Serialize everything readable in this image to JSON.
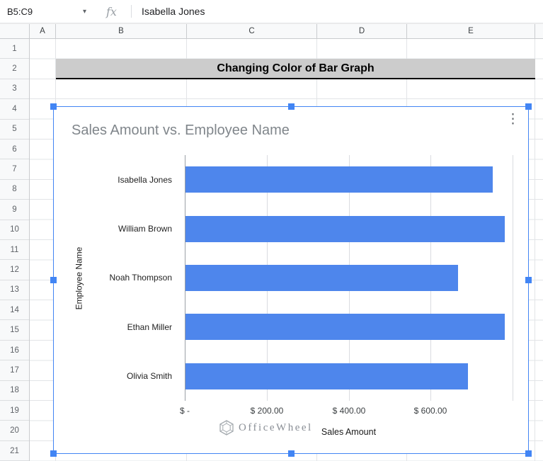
{
  "formula_bar": {
    "range": "B5:C9",
    "fx_label": "fx",
    "content": "Isabella Jones"
  },
  "icons": {
    "name_box_dropdown": "▾",
    "chart_menu": "⋮"
  },
  "colors": {
    "selection": "#4285f4"
  },
  "sheet": {
    "columns": [
      "A",
      "B",
      "C",
      "D",
      "E"
    ],
    "rows": [
      "1",
      "2",
      "3",
      "4",
      "5",
      "6",
      "7",
      "8",
      "9",
      "10",
      "11",
      "12",
      "13",
      "14",
      "15",
      "16",
      "17",
      "18",
      "19",
      "20",
      "21"
    ],
    "title_cell": {
      "text": "Changing Color of Bar Graph",
      "bg": "#cccccc"
    }
  },
  "chart": {
    "watermark": "OfficeWheel"
  },
  "chart_data": {
    "type": "bar",
    "orientation": "horizontal",
    "title": "Sales Amount vs. Employee Name",
    "categories": [
      "Isabella Jones",
      "William Brown",
      "Noah Thompson",
      "Ethan Miller",
      "Olivia Smith"
    ],
    "values": [
      750,
      780,
      665,
      780,
      690
    ],
    "xlabel": "Sales Amount",
    "ylabel": "Employee Name",
    "x_ticks": [
      "$ -",
      "$ 200.00",
      "$ 400.00",
      "$ 600.00"
    ],
    "x_tick_values": [
      0,
      200,
      400,
      600
    ],
    "xlim": [
      0,
      800
    ],
    "grid": true,
    "legend": "none",
    "bar_color": "#4e86ec"
  }
}
